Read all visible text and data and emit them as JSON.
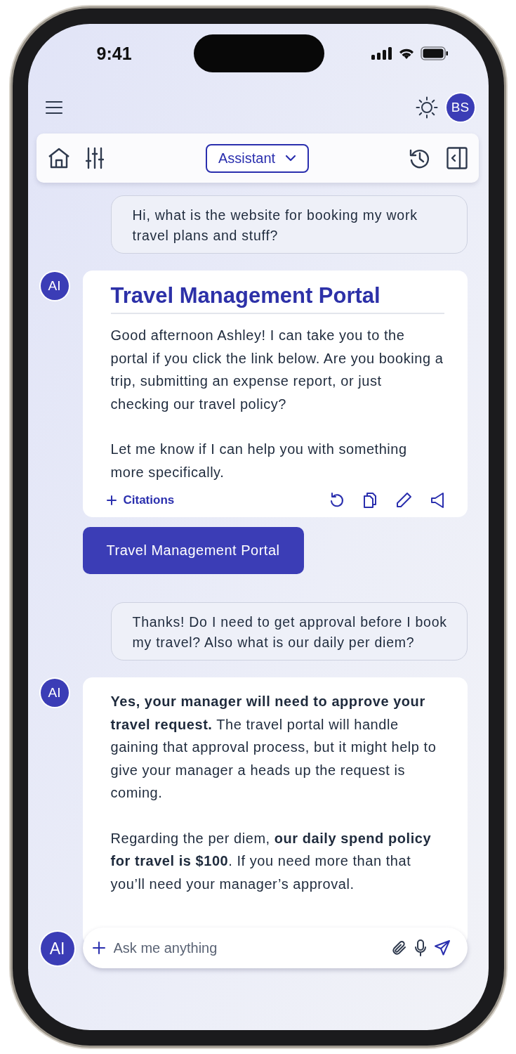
{
  "status_bar": {
    "time": "9:41"
  },
  "header": {
    "avatar_initials": "BS"
  },
  "toolbar": {
    "mode_dropdown": "Assistant"
  },
  "messages": [
    {
      "kind": "user",
      "text": "Hi, what is the website for booking my work travel plans and stuff?"
    },
    {
      "kind": "assistant",
      "avatar": "AI",
      "title": "Travel Management Portal",
      "paragraphs": [
        "Good afternoon Ashley! I can take you to the portal if you click the link below. Are you booking a trip, submitting an expense report, or just checking our travel policy?",
        "Let me know if I can help you with something more specifically."
      ],
      "citations": "Citations"
    },
    {
      "kind": "link_button",
      "label": "Travel Management Portal"
    },
    {
      "kind": "user",
      "text": "Thanks! Do I need to get approval before I book my travel? Also what is our daily per diem?"
    },
    {
      "kind": "assistant",
      "avatar": "AI",
      "paragraphs": [
        "**Yes, your manager will need to approve your travel request.** The travel portal will handle gaining that approval process, but it might help to give your manager a heads up the request is coming.",
        "Regarding the per diem, **our daily spend policy for travel is $100**. If you need more than that you’ll need your manager’s approval."
      ]
    }
  ],
  "composer": {
    "avatar": "AI",
    "placeholder": "Ask me anything"
  }
}
